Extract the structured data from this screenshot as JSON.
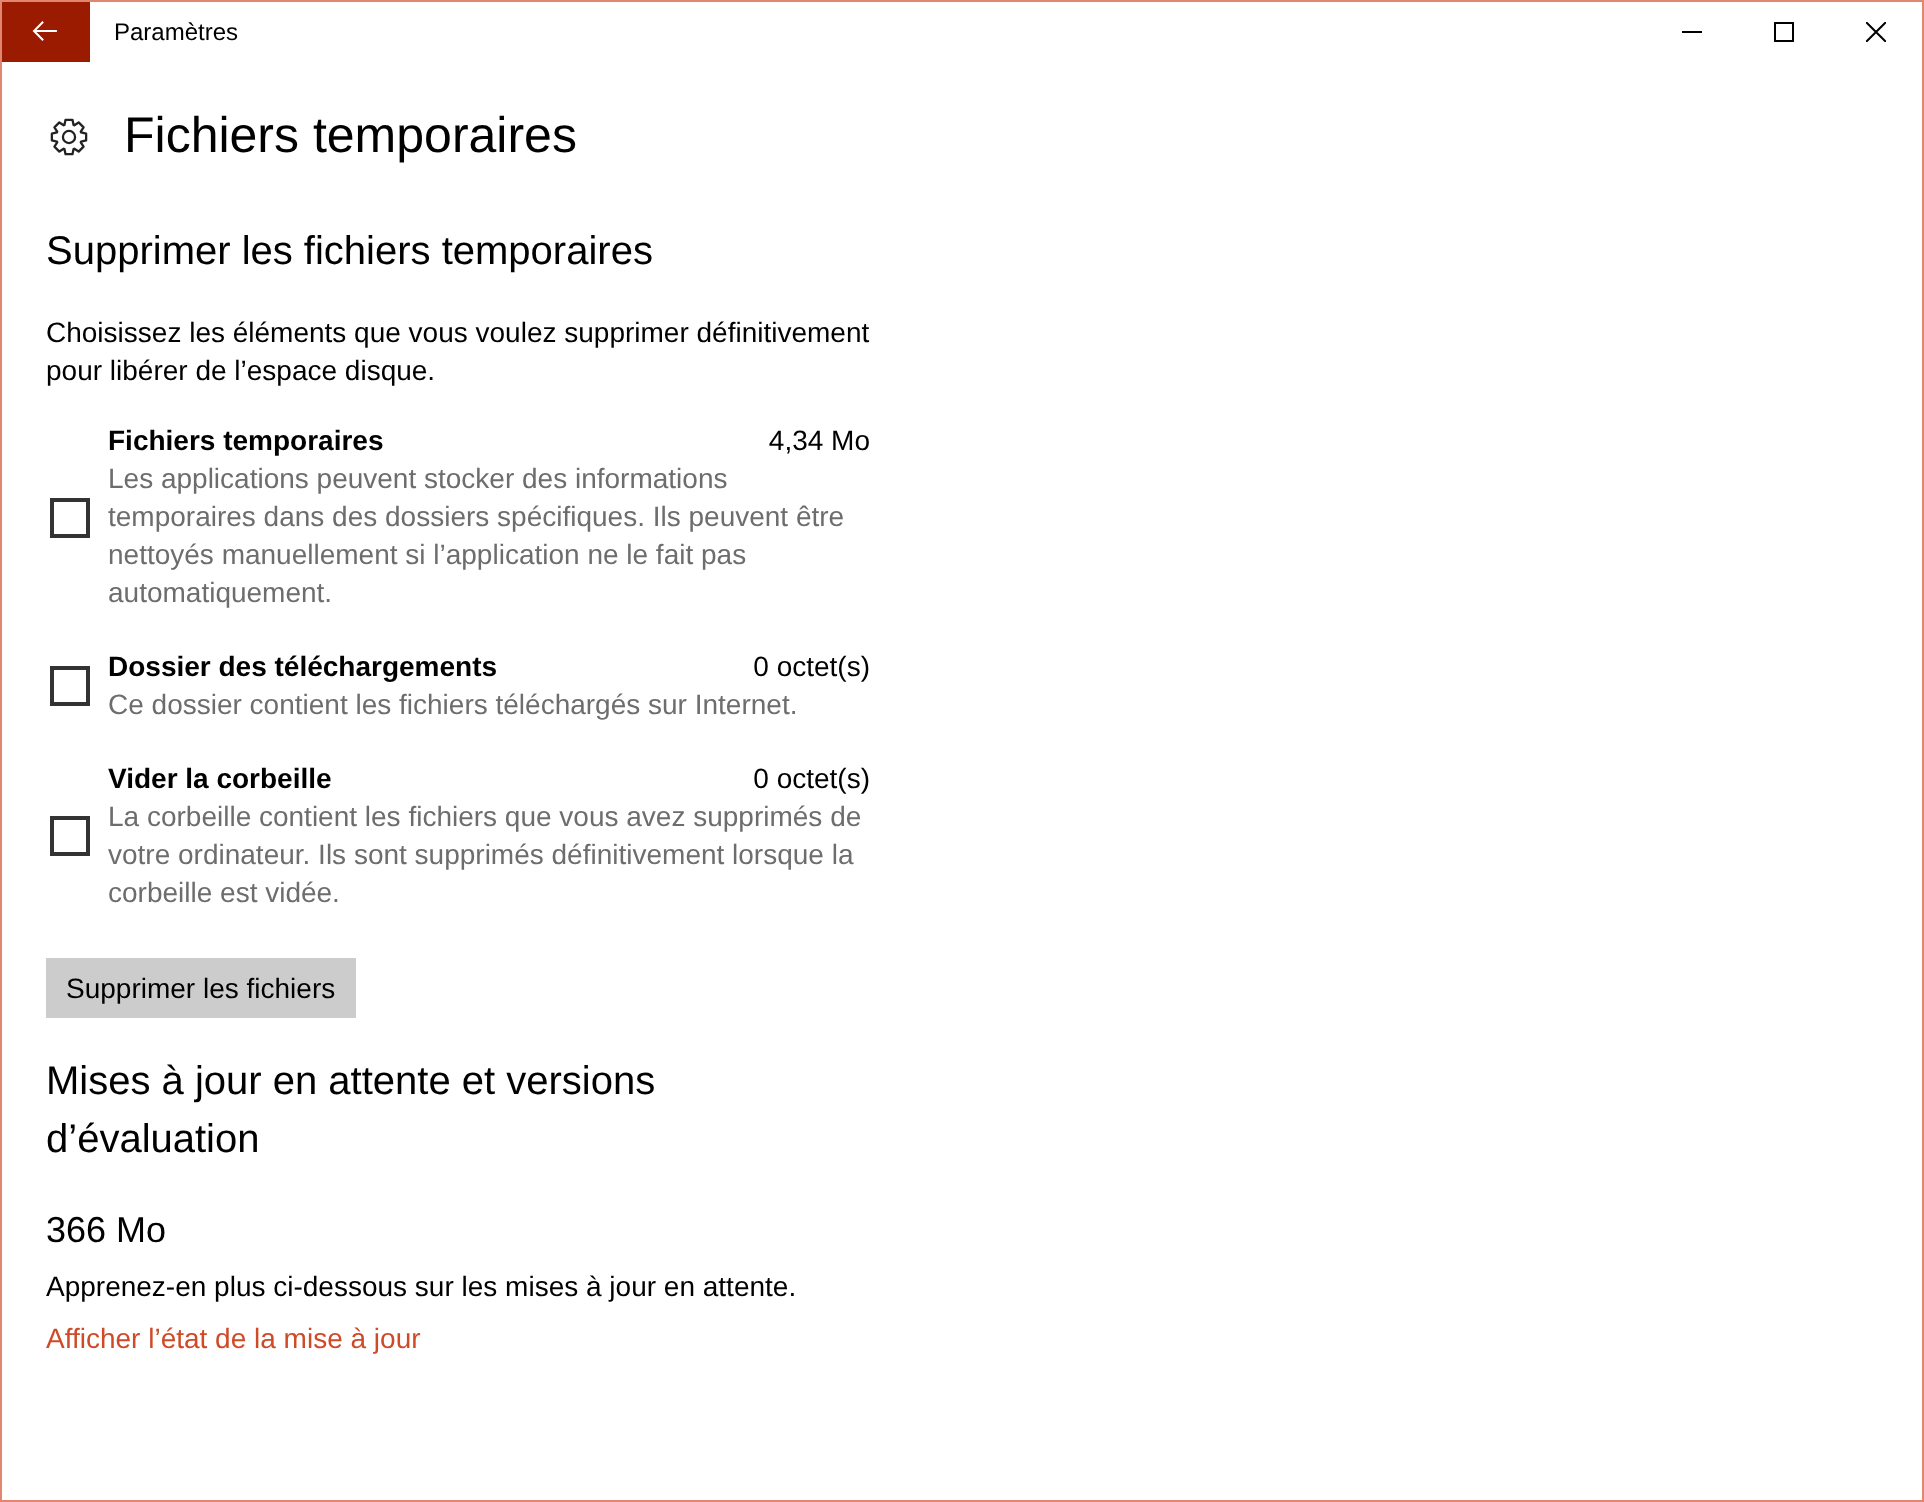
{
  "window": {
    "title": "Paramètres"
  },
  "page": {
    "title": "Fichiers temporaires"
  },
  "cleanup": {
    "heading": "Supprimer les fichiers temporaires",
    "description": "Choisissez les éléments que vous voulez supprimer définitivement pour libérer de l’espace disque.",
    "items": [
      {
        "title": "Fichiers temporaires",
        "size": "4,34 Mo",
        "description": "Les applications peuvent stocker des informations temporaires dans des dossiers spécifiques. Ils peuvent être nettoyés manuellement si l’application ne le fait pas automatiquement.",
        "checked": false
      },
      {
        "title": "Dossier des téléchargements",
        "size": "0 octet(s)",
        "description": "Ce dossier contient les fichiers téléchargés sur Internet.",
        "checked": false
      },
      {
        "title": "Vider la corbeille",
        "size": "0 octet(s)",
        "description": "La corbeille contient les fichiers que vous avez supprimés de votre ordinateur. Ils sont supprimés définitivement lorsque la corbeille est vidée.",
        "checked": false
      }
    ],
    "button": "Supprimer les fichiers"
  },
  "updates": {
    "heading": "Mises à jour en attente et versions d’évaluation",
    "size": "366 Mo",
    "description": "Apprenez-en plus ci-dessous sur les mises à jour en attente.",
    "link": "Afficher l’état de la mise à jour"
  }
}
